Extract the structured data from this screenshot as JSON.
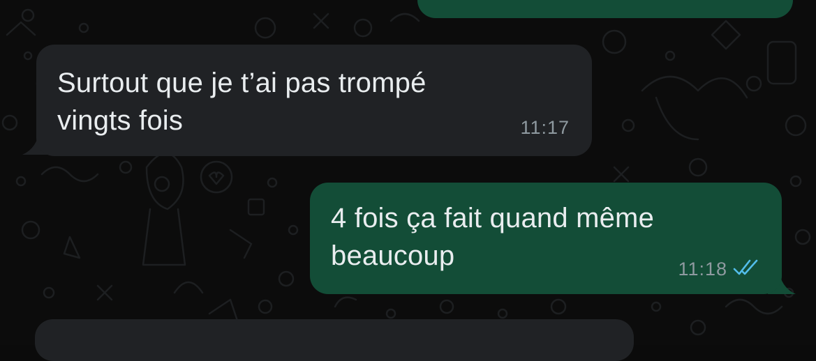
{
  "messages": [
    {
      "direction": "incoming",
      "text_line1": "Surtout que je t’ai pas trompé",
      "text_line2": "vingts fois",
      "time": "11:17"
    },
    {
      "direction": "outgoing",
      "text_line1": "4 fois ça fait quand même",
      "text_line2": "beaucoup",
      "time": "11:18",
      "status_icon": "double-check-read-icon"
    }
  ],
  "colors": {
    "background": "#0c0c0c",
    "incoming_bubble": "#202225",
    "outgoing_bubble": "#134d37",
    "text": "#e9edef",
    "timestamp": "#8f9aa0",
    "read_ticks": "#53bdeb"
  }
}
